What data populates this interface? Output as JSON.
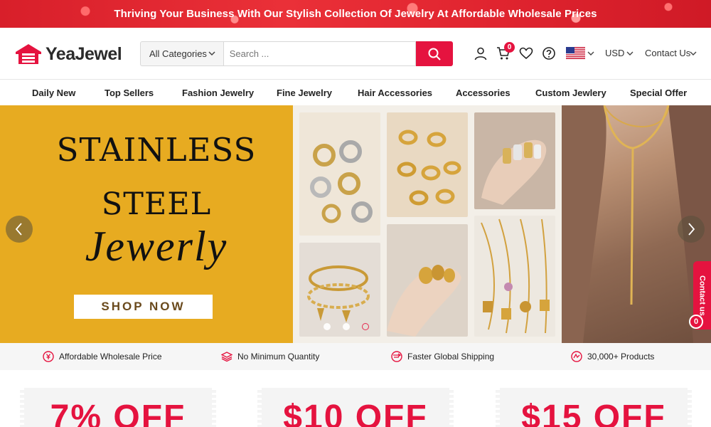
{
  "promo": {
    "text": "Thriving Your Business With Our Stylish Collection Of Jewelry At Affordable Wholesale Prices"
  },
  "header": {
    "logo_text": "YeaJewel",
    "category_label": "All Categories",
    "search_placeholder": "Search ...",
    "cart_count": "0",
    "currency": "USD",
    "contact": "Contact Us"
  },
  "nav": {
    "items": [
      "Daily New",
      "Top Sellers",
      "Fashion Jewelry",
      "Fine Jewelry",
      "Hair Accessories",
      "Accessories",
      "Custom Jewlery",
      "Special Offer"
    ]
  },
  "hero": {
    "line1": "STAINLESS",
    "line2": "STEEL",
    "line3": "Jewerly",
    "cta": "SHOP NOW",
    "slide_count": 3,
    "active_slide": 3
  },
  "contact_tab": {
    "label": "Contact us",
    "count": "0"
  },
  "features": [
    "Affordable Wholesale Price",
    "No Minimum Quantity",
    "Faster Global Shipping",
    "30,000+ Products"
  ],
  "coupons": [
    "7% OFF",
    "$10 OFF",
    "$15 OFF"
  ],
  "colors": {
    "accent": "#e5133f",
    "hero_yellow": "#e7ab21"
  },
  "icons": [
    "search-icon",
    "user-icon",
    "cart-icon",
    "heart-icon",
    "help-icon",
    "us-flag-icon",
    "chevron-down-icon",
    "chevron-left-icon",
    "chevron-right-icon"
  ]
}
